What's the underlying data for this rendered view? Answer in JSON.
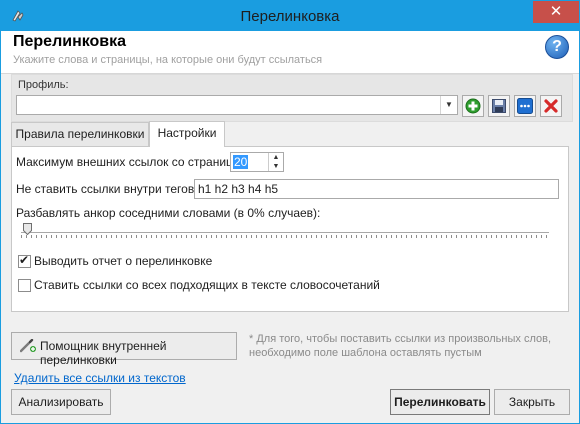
{
  "window": {
    "title": "Перелинковка",
    "close_symbol": "✕"
  },
  "header": {
    "title": "Перелинковка",
    "subtitle": "Укажите слова и страницы, на которые они будут ссылаться",
    "help_symbol": "?"
  },
  "profile": {
    "label": "Профиль:",
    "value": ""
  },
  "tabs": [
    {
      "label": "Правила перелинковки",
      "active": false
    },
    {
      "label": "Настройки",
      "active": true
    }
  ],
  "settings": {
    "max_links_label": "Максимум внешних ссылок со страницы:",
    "max_links_value": "20",
    "no_tags_label": "Не ставить ссылки внутри тегов:",
    "no_tags_value": "h1 h2 h3 h4 h5",
    "dilute_label": "Разбавлять анкор соседними словами  (в 0% случаев):",
    "dilute_percent": 0,
    "report_label": "Выводить отчет о перелинковке",
    "report_checked": true,
    "all_phrases_label": "Ставить ссылки со всех подходящих в тексте словосочетаний",
    "all_phrases_checked": false
  },
  "assistant_button": "Помощник внутренней перелинковки",
  "note": "* Для того, чтобы поставить ссылки из произвольных слов, необходимо поле шаблона оставлять пустым",
  "remove_links": "Удалить все ссылки из текстов",
  "buttons": {
    "analyze": "Анализировать",
    "relink": "Перелинковать",
    "close": "Закрыть"
  },
  "colors": {
    "titlebar": "#1a9de0",
    "close": "#c7504a",
    "link": "#0066cc",
    "add_green": "#2e9e2e",
    "delete_red": "#d62a2a",
    "options_blue": "#1f6fd1"
  }
}
